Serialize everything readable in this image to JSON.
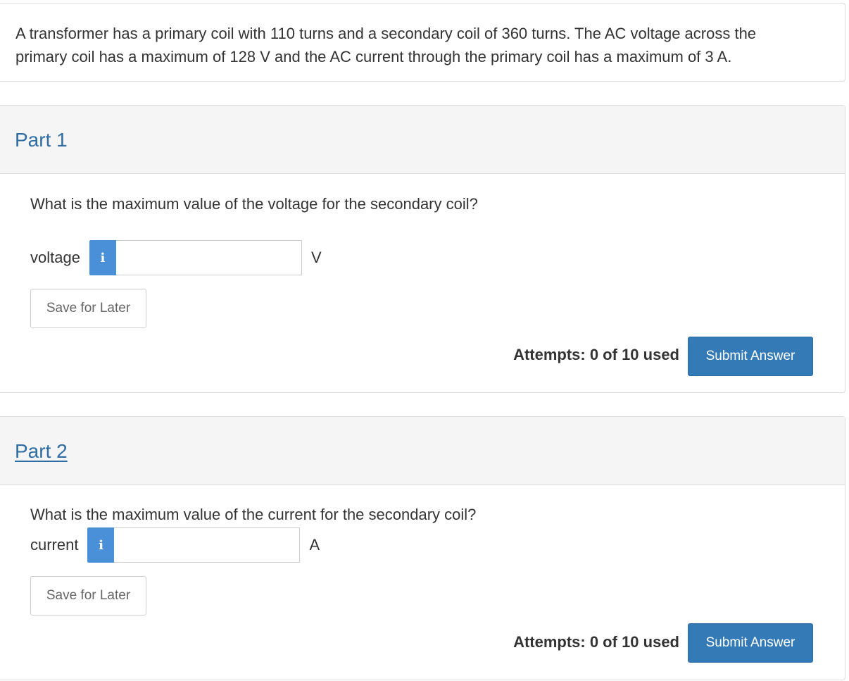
{
  "question": {
    "text_line1": "A transformer has a primary coil with 110 turns and a secondary coil of 360 turns. The AC voltage across the",
    "text_line2": "primary coil has a maximum of 128 V and the AC current through the primary coil has a maximum of 3 A."
  },
  "parts": [
    {
      "title": "Part 1",
      "prompt": "What is the maximum value of the voltage for the secondary coil?",
      "answer_label": "voltage",
      "info_icon": "i",
      "input_value": "",
      "unit": "V",
      "save_label": "Save for Later",
      "attempts": "Attempts: 0 of 10 used",
      "submit_label": "Submit Answer"
    },
    {
      "title": "Part 2",
      "prompt": "What is the maximum value of the current for the secondary coil?",
      "answer_label": "current",
      "info_icon": "i",
      "input_value": "",
      "unit": "A",
      "save_label": "Save for Later",
      "attempts": "Attempts: 0 of 10 used",
      "submit_label": "Submit Answer"
    }
  ],
  "colors": {
    "accent_link": "#2e6da4",
    "info_button": "#4a90d9",
    "submit_button": "#337ab7",
    "header_bg": "#f5f5f5"
  }
}
